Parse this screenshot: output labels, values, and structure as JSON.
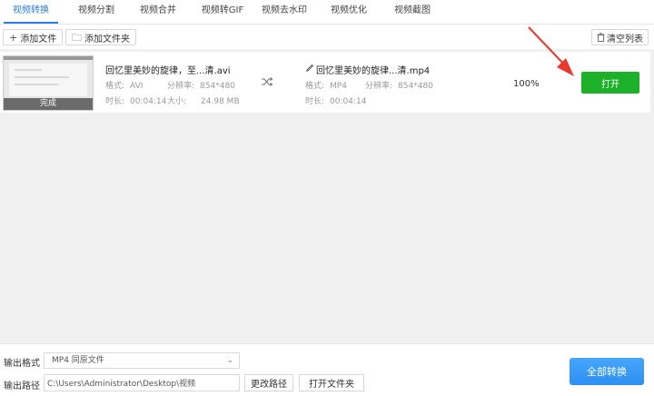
{
  "tabs": [
    {
      "label": "视频转换",
      "active": true
    },
    {
      "label": "视频分割"
    },
    {
      "label": "视频合并"
    },
    {
      "label": "视频转GIF"
    },
    {
      "label": "视频去水印"
    },
    {
      "label": "视频优化"
    },
    {
      "label": "视频截图"
    }
  ],
  "toolbar": {
    "add_file": "添加文件",
    "add_folder": "添加文件夹",
    "clear_list": "清空列表",
    "plus_icon": "+",
    "folder_icon": "🗀",
    "trash_icon": "🗑"
  },
  "file_row": {
    "thumb_status": "完成",
    "source": {
      "name": "回忆里美妙的旋律，至...清.avi",
      "format_label": "格式:",
      "format": "AVI",
      "resolution_label": "分辨率:",
      "resolution": "854*480",
      "duration_label": "时长:",
      "duration": "00:04:14",
      "size_label": "大小:",
      "size": "24.98 MB"
    },
    "output": {
      "name": "回忆里美妙的旋律...清.mp4",
      "format_label": "格式:",
      "format": "MP4",
      "resolution_label": "分辨率:",
      "resolution": "854*480",
      "duration_label": "时长:",
      "duration": "00:04:14"
    },
    "progress": "100%",
    "open_label": "打开"
  },
  "bottom": {
    "format_label": "输出格式",
    "format_value": "MP4  同原文件",
    "path_label": "输出路径",
    "path_value": "C:\\Users\\Administrator\\Desktop\\视频",
    "change_path": "更改路径",
    "open_folder": "打开文件夹",
    "convert_all": "全部转换"
  },
  "colors": {
    "accent": "#2b7de9",
    "open_button": "#1db12a",
    "convert_button": "#3d9eff",
    "arrow": "#e8392f"
  }
}
